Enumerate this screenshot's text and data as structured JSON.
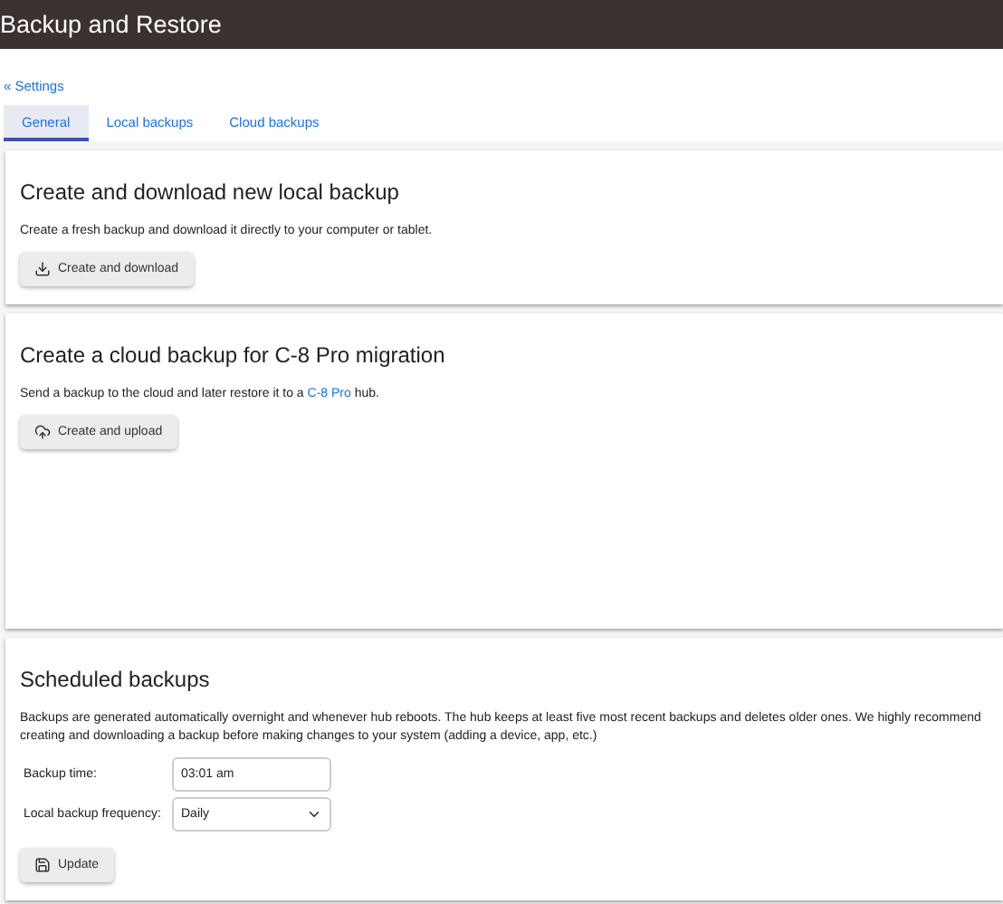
{
  "header": {
    "title": "Backup and Restore"
  },
  "back_link": "« Settings",
  "tabs": [
    {
      "label": "General",
      "selected": true
    },
    {
      "label": "Local backups",
      "selected": false
    },
    {
      "label": "Cloud backups",
      "selected": false
    }
  ],
  "cards": [
    {
      "title": "Create and download new local backup",
      "text": {
        "before": "Create a fresh backup and download it directly to your computer or tablet."
      },
      "button": {
        "label": "Create and download"
      }
    },
    {
      "title": "Create a cloud backup for C-8 Pro migration",
      "text": {
        "before": "Send a backup to the cloud and later restore it to a ",
        "link": "C-8 Pro",
        "after": " hub."
      },
      "button": {
        "label": "Create and upload"
      }
    }
  ],
  "scheduled": {
    "title": "Scheduled backups",
    "text": "Backups are generated automatically overnight and whenever hub reboots. The hub keeps at least five most recent backups and deletes older ones. We highly recommend creating and downloading a backup before making changes to your system (adding a device, app, etc.)",
    "time_label": "Backup time:",
    "time_value": "03:01 am",
    "frequency_label": "Local backup frequency:",
    "frequency_value": "Daily",
    "button": {
      "label": "Update"
    }
  }
}
